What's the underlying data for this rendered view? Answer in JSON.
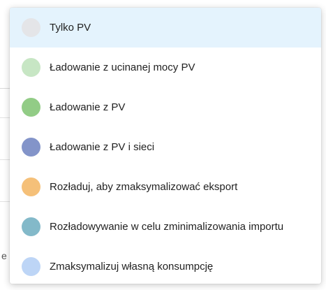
{
  "dropdown": {
    "selected_index": 0,
    "options": [
      {
        "label": "Tylko PV",
        "color": "#e4e5e8"
      },
      {
        "label": "Ładowanie z ucinanej mocy PV",
        "color": "#c7e6c4"
      },
      {
        "label": "Ładowanie z PV",
        "color": "#92cc86"
      },
      {
        "label": "Ładowanie z PV i sieci",
        "color": "#8394c9"
      },
      {
        "label": "Rozładuj, aby zmaksymalizować eksport",
        "color": "#f5c079"
      },
      {
        "label": "Rozładowywanie w celu zminimalizowania importu",
        "color": "#83b9c9"
      },
      {
        "label": "Zmaksymalizuj własną konsumpcję",
        "color": "#bdd5f6"
      }
    ]
  },
  "background": {
    "partial_letter": "e"
  }
}
